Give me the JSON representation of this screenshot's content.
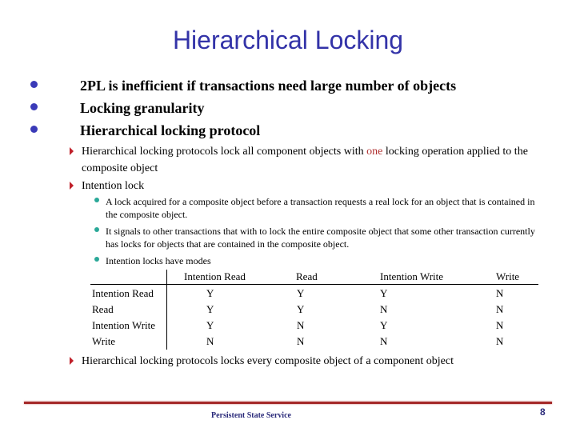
{
  "title": "Hierarchical Locking",
  "bullets": [
    "2PL is inefficient if transactions need large number of objects",
    "Locking granularity",
    "Hierarchical locking protocol"
  ],
  "sub_bullets": {
    "b1_pre": "Hierarchical locking protocols lock all component objects with ",
    "b1_highlight": "one",
    "b1_post": " locking operation applied to the composite object",
    "b2": "Intention lock",
    "b3": "Hierarchical locking protocols locks every composite object of a component object"
  },
  "intention_points": [
    "A lock acquired for a composite object before a transaction requests a real lock for an object that is contained in the composite object.",
    "It signals to other transactions that with to lock the entire composite object that some other transaction currently has locks for objects that are contained in the composite object.",
    "Intention locks have modes"
  ],
  "table": {
    "columns": [
      "Intention Read",
      "Read",
      "Intention Write",
      "Write"
    ],
    "rows": [
      {
        "label": "Intention Read",
        "values": [
          "Y",
          "Y",
          "Y",
          "N"
        ]
      },
      {
        "label": "Read",
        "values": [
          "Y",
          "Y",
          "N",
          "N"
        ]
      },
      {
        "label": "Intention Write",
        "values": [
          "Y",
          "N",
          "Y",
          "N"
        ]
      },
      {
        "label": "Write",
        "values": [
          "N",
          "N",
          "N",
          "N"
        ]
      }
    ]
  },
  "footer": {
    "text": "Persistent State Service",
    "page_number": "8"
  },
  "colors": {
    "title": "#3333a8",
    "highlight": "#b03030",
    "footer_rule": "#a52a2a"
  }
}
